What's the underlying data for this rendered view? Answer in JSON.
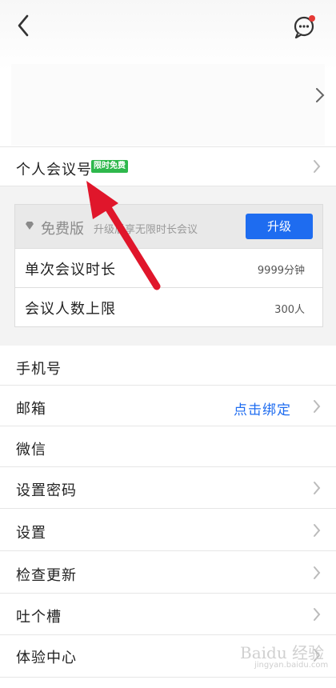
{
  "profile": {
    "meeting_id_label": "个人会议号",
    "free_badge": "限时免费"
  },
  "plan_card": {
    "version": "免费版",
    "promo": "升级后享无限时长会议",
    "upgrade_label": "升级",
    "rows": [
      {
        "key": "单次会议时长",
        "value": "9999分钟"
      },
      {
        "key": "会议人数上限",
        "value": "300人"
      }
    ]
  },
  "menu": {
    "phone": "手机号",
    "email": "邮箱",
    "email_action": "点击绑定",
    "wechat": "微信",
    "password": "设置密码",
    "settings": "设置",
    "check_update": "检查更新",
    "feedback": "吐个槽",
    "experience": "体验中心"
  },
  "watermark": {
    "text": "Baidu 经验",
    "sub": "jingyan.baidu.com"
  },
  "colors": {
    "accent": "#1e6cf0",
    "badge": "#2eb84c",
    "arrow": "#e0162b",
    "notify_dot": "#e53935"
  }
}
